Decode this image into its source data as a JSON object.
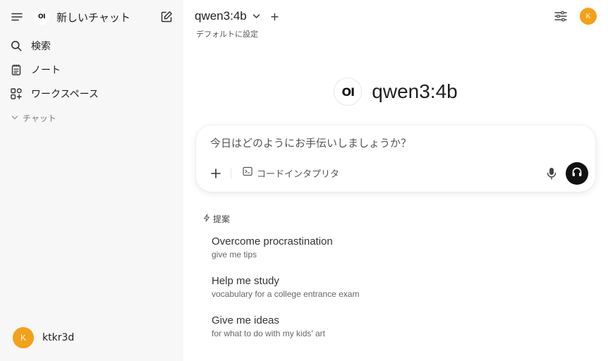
{
  "sidebar": {
    "logo_text": "OI",
    "new_chat_label": "新しいチャット",
    "items": [
      {
        "label": "検索",
        "icon": "search-icon"
      },
      {
        "label": "ノート",
        "icon": "note-icon"
      },
      {
        "label": "ワークスペース",
        "icon": "workspace-icon"
      }
    ],
    "section_label": "チャット",
    "user": {
      "initial": "K",
      "name": "ktkr3d"
    }
  },
  "header": {
    "model_name": "qwen3:4b",
    "add_label": "+",
    "set_default_label": "デフォルトに設定",
    "avatar_initial": "K"
  },
  "hero": {
    "logo_text": "OI",
    "title": "qwen3:4b"
  },
  "prompt": {
    "placeholder": "今日はどのようにお手伝いしましょうか？",
    "tool_label": "コードインタプリタ"
  },
  "suggestions": {
    "heading": "提案",
    "items": [
      {
        "title": "Overcome procrastination",
        "subtitle": "give me tips"
      },
      {
        "title": "Help me study",
        "subtitle": "vocabulary for a college entrance exam"
      },
      {
        "title": "Give me ideas",
        "subtitle": "for what to do with my kids' art"
      }
    ]
  },
  "colors": {
    "accent_avatar": "#f4a019",
    "sidebar_bg": "#f7f7f7",
    "voice_button": "#111111"
  }
}
